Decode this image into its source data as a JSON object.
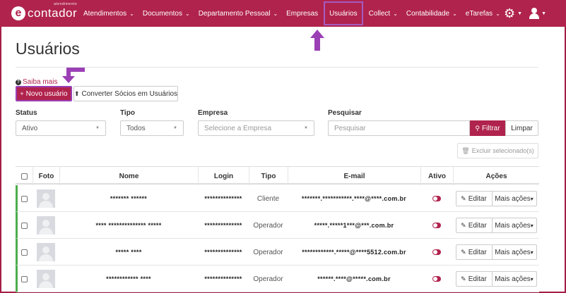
{
  "brand": {
    "text": "contador",
    "small": "atendimento",
    "letter": "e"
  },
  "nav": [
    {
      "label": "Atendimentos",
      "caret": true
    },
    {
      "label": "Documentos",
      "caret": true
    },
    {
      "label": "Departamento Pessoal",
      "caret": true
    },
    {
      "label": "Empresas",
      "caret": false
    },
    {
      "label": "Usuários",
      "caret": false,
      "active": true
    },
    {
      "label": "Collect",
      "caret": true
    },
    {
      "label": "Contabilidade",
      "caret": true
    },
    {
      "label": "eTarefas",
      "caret": true
    }
  ],
  "page": {
    "title": "Usuários"
  },
  "help": {
    "label": "Saiba mais"
  },
  "buttons": {
    "novo": "Novo usuário",
    "converter": "Converter Sócios em Usuários",
    "filtrar": "Filtrar",
    "limpar": "Limpar",
    "excluir": "Excluir selecionado(s)"
  },
  "filters": {
    "status": {
      "label": "Status",
      "value": "Ativo"
    },
    "tipo": {
      "label": "Tipo",
      "value": "Todos"
    },
    "empresa": {
      "label": "Empresa",
      "placeholder": "Selecione a Empresa"
    },
    "pesquisar": {
      "label": "Pesquisar",
      "placeholder": "Pesquisar"
    }
  },
  "table": {
    "headers": [
      "Foto",
      "Nome",
      "Login",
      "Tipo",
      "E-mail",
      "Ativo",
      "Ações"
    ],
    "rows": [
      {
        "nome": "******* ******",
        "login": "**************",
        "tipo": "Cliente",
        "email": "*******.***********.****@****.com.br",
        "ativo": true
      },
      {
        "nome": "**** ************** *****",
        "login": "**************",
        "tipo": "Operador",
        "email": "*****.*****1***@***.com.br",
        "ativo": true
      },
      {
        "nome": "***** ****",
        "login": "**************",
        "tipo": "Operador",
        "email": "************.*****@****5512.com.br",
        "ativo": true
      },
      {
        "nome": "************ ****",
        "login": "**************",
        "tipo": "Operador",
        "email": "******.****@*****.com.br",
        "ativo": true
      }
    ],
    "actions": {
      "edit": "Editar",
      "more": "Mais ações"
    }
  },
  "colors": {
    "brand": "#b0234d",
    "highlight": "#9b3fb5",
    "rowAccent": "#4cae4c"
  }
}
